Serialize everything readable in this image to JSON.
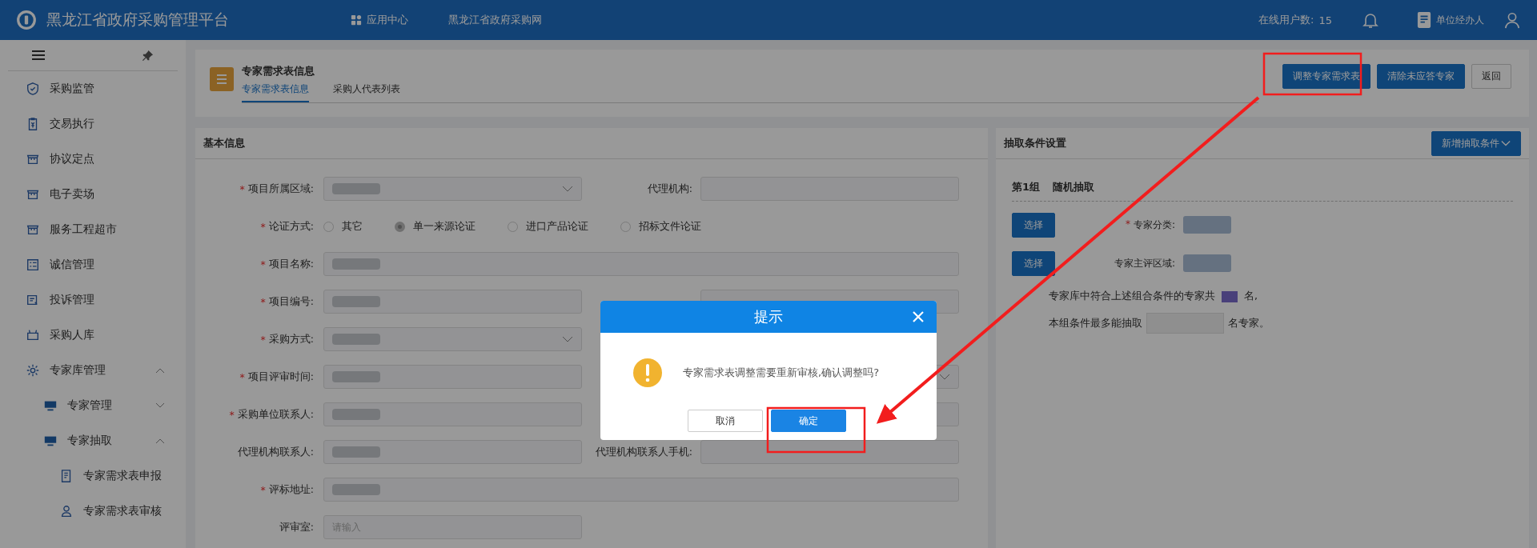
{
  "topbar": {
    "title": "黑龙江省政府采购管理平台",
    "nav": [
      {
        "label": "应用中心",
        "kind": "apps"
      },
      {
        "label": "黑龙江省政府采购网",
        "kind": "link"
      }
    ],
    "online_label": "在线用户数:",
    "online_count": "15",
    "user_role": "单位经办人"
  },
  "sidebar": {
    "items": [
      {
        "label": "采购监管"
      },
      {
        "label": "交易执行"
      },
      {
        "label": "协议定点"
      },
      {
        "label": "电子卖场"
      },
      {
        "label": "服务工程超市"
      },
      {
        "label": "诚信管理"
      },
      {
        "label": "投诉管理"
      },
      {
        "label": "采购人库"
      },
      {
        "label": "专家库管理",
        "expanded": true,
        "children": [
          {
            "label": "专家管理",
            "expanded": false
          },
          {
            "label": "专家抽取",
            "expanded": true,
            "children": [
              {
                "label": "专家需求表申报"
              },
              {
                "label": "专家需求表审核"
              }
            ]
          }
        ]
      }
    ]
  },
  "header": {
    "title": "专家需求表信息",
    "tabs": [
      {
        "label": "专家需求表信息",
        "selected": true
      },
      {
        "label": "采购人代表列表",
        "selected": false
      }
    ],
    "buttons": [
      {
        "label": "调整专家需求表",
        "kind": "primary"
      },
      {
        "label": "清除未应答专家",
        "kind": "primary"
      },
      {
        "label": "返回",
        "kind": "plain"
      }
    ]
  },
  "basic_info": {
    "title": "基本信息",
    "rows": [
      {
        "kind": "pair",
        "left": {
          "required": "*",
          "label": "项目所属区域:",
          "dropdown": true
        },
        "right": {
          "label": "代理机构:"
        }
      },
      {
        "kind": "radio",
        "required": "*",
        "label": "论证方式:",
        "options": [
          {
            "label": "其它",
            "selected": false
          },
          {
            "label": "单一来源论证",
            "selected": true
          },
          {
            "label": "进口产品论证",
            "selected": false
          },
          {
            "label": "招标文件论证",
            "selected": false
          }
        ]
      },
      {
        "kind": "wide",
        "required": "*",
        "label": "项目名称:"
      },
      {
        "kind": "pair",
        "left": {
          "required": "*",
          "label": "项目编号:"
        },
        "right": {}
      },
      {
        "kind": "pair",
        "left": {
          "required": "*",
          "label": "采购方式:",
          "dropdown": true
        }
      },
      {
        "kind": "pair",
        "left": {
          "required": "*",
          "label": "项目评审时间:"
        },
        "right": {
          "dropdown": true
        }
      },
      {
        "kind": "pair",
        "left": {
          "required": "*",
          "label": "采购单位联系人:"
        },
        "right": {}
      },
      {
        "kind": "pair",
        "left": {
          "label": "代理机构联系人:"
        },
        "right": {
          "label": "代理机构联系人手机:"
        }
      },
      {
        "kind": "wide",
        "required": "*",
        "label": "评标地址:"
      },
      {
        "kind": "pair",
        "left": {
          "label": "评审室:",
          "placeholder": "请输入"
        }
      }
    ]
  },
  "conditions": {
    "title": "抽取条件设置",
    "add_button": "新增抽取条件",
    "group": "第1组",
    "group_type": "随机抽取",
    "rows": [
      {
        "button": "选择",
        "required": "*",
        "label": "专家分类:"
      },
      {
        "button": "选择",
        "label": "专家主评区域:"
      }
    ],
    "count_before": "专家库中符合上述组合条件的专家共",
    "count_after": "名,",
    "max_before": "本组条件最多能抽取",
    "max_after": "名专家。"
  },
  "dialog": {
    "title": "提示",
    "message": "专家需求表调整需要重新审核,确认调整吗?",
    "cancel": "取消",
    "confirm": "确定"
  }
}
